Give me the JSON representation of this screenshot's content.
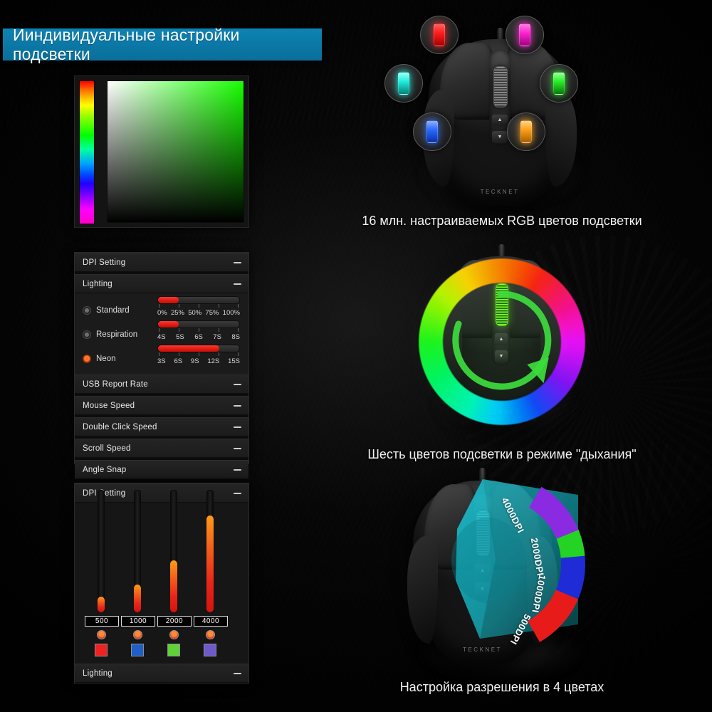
{
  "header": {
    "title": "Ииндивидуальные настройки подсветки",
    "accent_color": "#0b7cab"
  },
  "color_picker": {
    "name": "color-picker",
    "hue_strip_colors": [
      "#ff0000",
      "#ffff00",
      "#00ff00",
      "#00ffff",
      "#0000ff",
      "#ff00ff"
    ],
    "selected_hue": "#17ff00"
  },
  "settings_panel": {
    "rows": [
      {
        "label": "DPI Setting",
        "collapse_icon": "minus-icon"
      },
      {
        "label": "Lighting",
        "collapse_icon": "minus-icon"
      }
    ],
    "modes": [
      {
        "label": "Standard",
        "selected": false,
        "slider_percent": 25,
        "scale": [
          "0%",
          "25%",
          "50%",
          "75%",
          "100%"
        ]
      },
      {
        "label": "Respiration",
        "selected": false,
        "slider_percent": 25,
        "scale": [
          "4S",
          "5S",
          "6S",
          "7S",
          "8S"
        ]
      },
      {
        "label": "Neon",
        "selected": true,
        "slider_percent": 75,
        "scale": [
          "3S",
          "6S",
          "9S",
          "12S",
          "15S"
        ]
      }
    ],
    "other_rows": [
      {
        "label": "USB Report Rate",
        "collapse_icon": "minus-icon"
      },
      {
        "label": "Mouse Speed",
        "collapse_icon": "minus-icon"
      },
      {
        "label": "Double Click Speed",
        "collapse_icon": "minus-icon"
      },
      {
        "label": "Scroll Speed",
        "collapse_icon": "minus-icon"
      },
      {
        "label": "Angle Snap",
        "collapse_icon": "minus-icon"
      }
    ]
  },
  "dpi_panel": {
    "header": {
      "label": "DPI Setting",
      "collapse_icon": "minus-icon"
    },
    "footer": {
      "label": "Lighting",
      "collapse_icon": "minus-icon"
    },
    "levels": [
      {
        "value": "500",
        "fill_percent": 13,
        "swatch": "#ee2222"
      },
      {
        "value": "1000",
        "fill_percent": 23,
        "swatch": "#1f5fc7"
      },
      {
        "value": "2000",
        "fill_percent": 43,
        "swatch": "#5fd23a"
      },
      {
        "value": "4000",
        "fill_percent": 80,
        "swatch": "#7059c9"
      }
    ]
  },
  "showcase": {
    "rgb_colors_caption": "16 млн. настраиваемых RGB цветов подсветки",
    "breathing_caption": "Шесть цветов подсветки в режиме \"дыхания\"",
    "dpi_caption": "Настройка разрешения в 4 цветах",
    "brand": "TECKNET",
    "led_bubbles": [
      {
        "name": "led-red",
        "color": "#ff1e1e"
      },
      {
        "name": "led-magenta",
        "color": "#ff25cf"
      },
      {
        "name": "led-cyan",
        "color": "#21efe0"
      },
      {
        "name": "led-green",
        "color": "#2bf02b"
      },
      {
        "name": "led-blue",
        "color": "#2b6bff"
      },
      {
        "name": "led-orange",
        "color": "#ffa116"
      }
    ],
    "dpi_arc": [
      {
        "label": "4000DPI",
        "color": "#8a2be2"
      },
      {
        "label": "2000DPI",
        "color": "#24d324"
      },
      {
        "label": "1000DPI",
        "color": "#1f2bd6"
      },
      {
        "label": "500DPI",
        "color": "#e81b1b"
      }
    ]
  }
}
